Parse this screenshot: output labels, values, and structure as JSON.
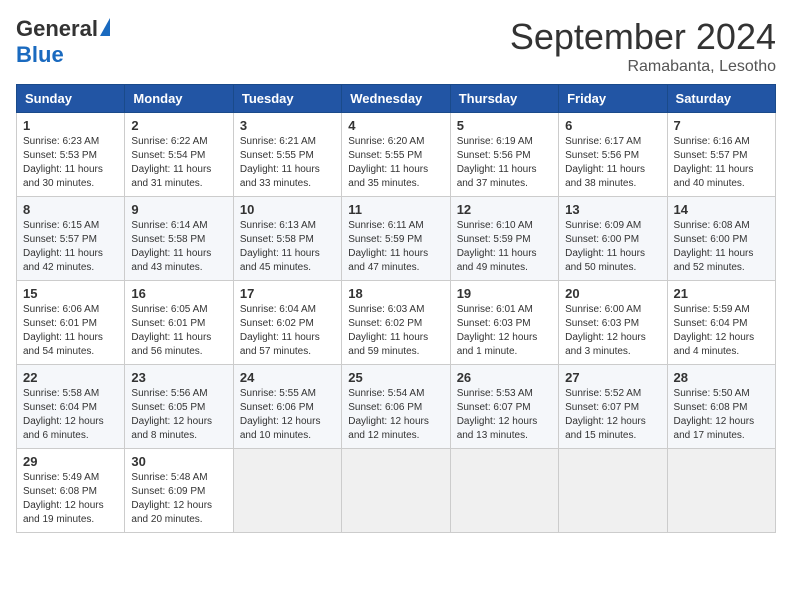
{
  "header": {
    "logo_general": "General",
    "logo_blue": "Blue",
    "month": "September 2024",
    "location": "Ramabanta, Lesotho"
  },
  "weekdays": [
    "Sunday",
    "Monday",
    "Tuesday",
    "Wednesday",
    "Thursday",
    "Friday",
    "Saturday"
  ],
  "weeks": [
    [
      {
        "day": "1",
        "sunrise": "6:23 AM",
        "sunset": "5:53 PM",
        "daylight": "11 hours and 30 minutes."
      },
      {
        "day": "2",
        "sunrise": "6:22 AM",
        "sunset": "5:54 PM",
        "daylight": "11 hours and 31 minutes."
      },
      {
        "day": "3",
        "sunrise": "6:21 AM",
        "sunset": "5:55 PM",
        "daylight": "11 hours and 33 minutes."
      },
      {
        "day": "4",
        "sunrise": "6:20 AM",
        "sunset": "5:55 PM",
        "daylight": "11 hours and 35 minutes."
      },
      {
        "day": "5",
        "sunrise": "6:19 AM",
        "sunset": "5:56 PM",
        "daylight": "11 hours and 37 minutes."
      },
      {
        "day": "6",
        "sunrise": "6:17 AM",
        "sunset": "5:56 PM",
        "daylight": "11 hours and 38 minutes."
      },
      {
        "day": "7",
        "sunrise": "6:16 AM",
        "sunset": "5:57 PM",
        "daylight": "11 hours and 40 minutes."
      }
    ],
    [
      {
        "day": "8",
        "sunrise": "6:15 AM",
        "sunset": "5:57 PM",
        "daylight": "11 hours and 42 minutes."
      },
      {
        "day": "9",
        "sunrise": "6:14 AM",
        "sunset": "5:58 PM",
        "daylight": "11 hours and 43 minutes."
      },
      {
        "day": "10",
        "sunrise": "6:13 AM",
        "sunset": "5:58 PM",
        "daylight": "11 hours and 45 minutes."
      },
      {
        "day": "11",
        "sunrise": "6:11 AM",
        "sunset": "5:59 PM",
        "daylight": "11 hours and 47 minutes."
      },
      {
        "day": "12",
        "sunrise": "6:10 AM",
        "sunset": "5:59 PM",
        "daylight": "11 hours and 49 minutes."
      },
      {
        "day": "13",
        "sunrise": "6:09 AM",
        "sunset": "6:00 PM",
        "daylight": "11 hours and 50 minutes."
      },
      {
        "day": "14",
        "sunrise": "6:08 AM",
        "sunset": "6:00 PM",
        "daylight": "11 hours and 52 minutes."
      }
    ],
    [
      {
        "day": "15",
        "sunrise": "6:06 AM",
        "sunset": "6:01 PM",
        "daylight": "11 hours and 54 minutes."
      },
      {
        "day": "16",
        "sunrise": "6:05 AM",
        "sunset": "6:01 PM",
        "daylight": "11 hours and 56 minutes."
      },
      {
        "day": "17",
        "sunrise": "6:04 AM",
        "sunset": "6:02 PM",
        "daylight": "11 hours and 57 minutes."
      },
      {
        "day": "18",
        "sunrise": "6:03 AM",
        "sunset": "6:02 PM",
        "daylight": "11 hours and 59 minutes."
      },
      {
        "day": "19",
        "sunrise": "6:01 AM",
        "sunset": "6:03 PM",
        "daylight": "12 hours and 1 minute."
      },
      {
        "day": "20",
        "sunrise": "6:00 AM",
        "sunset": "6:03 PM",
        "daylight": "12 hours and 3 minutes."
      },
      {
        "day": "21",
        "sunrise": "5:59 AM",
        "sunset": "6:04 PM",
        "daylight": "12 hours and 4 minutes."
      }
    ],
    [
      {
        "day": "22",
        "sunrise": "5:58 AM",
        "sunset": "6:04 PM",
        "daylight": "12 hours and 6 minutes."
      },
      {
        "day": "23",
        "sunrise": "5:56 AM",
        "sunset": "6:05 PM",
        "daylight": "12 hours and 8 minutes."
      },
      {
        "day": "24",
        "sunrise": "5:55 AM",
        "sunset": "6:06 PM",
        "daylight": "12 hours and 10 minutes."
      },
      {
        "day": "25",
        "sunrise": "5:54 AM",
        "sunset": "6:06 PM",
        "daylight": "12 hours and 12 minutes."
      },
      {
        "day": "26",
        "sunrise": "5:53 AM",
        "sunset": "6:07 PM",
        "daylight": "12 hours and 13 minutes."
      },
      {
        "day": "27",
        "sunrise": "5:52 AM",
        "sunset": "6:07 PM",
        "daylight": "12 hours and 15 minutes."
      },
      {
        "day": "28",
        "sunrise": "5:50 AM",
        "sunset": "6:08 PM",
        "daylight": "12 hours and 17 minutes."
      }
    ],
    [
      {
        "day": "29",
        "sunrise": "5:49 AM",
        "sunset": "6:08 PM",
        "daylight": "12 hours and 19 minutes."
      },
      {
        "day": "30",
        "sunrise": "5:48 AM",
        "sunset": "6:09 PM",
        "daylight": "12 hours and 20 minutes."
      },
      null,
      null,
      null,
      null,
      null
    ]
  ]
}
